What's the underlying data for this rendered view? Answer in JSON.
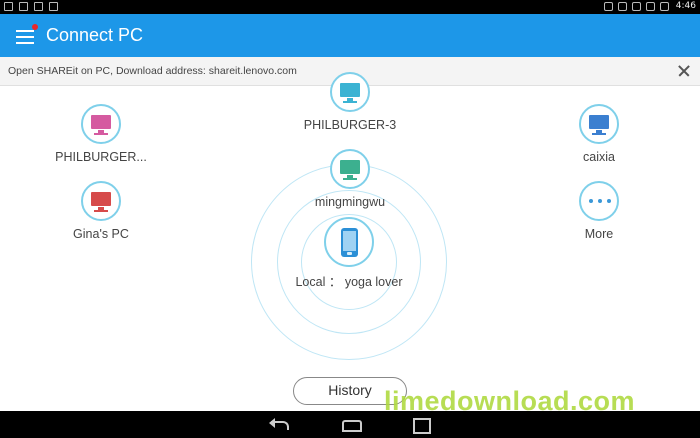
{
  "status_bar": {
    "time": "4:46"
  },
  "app_bar": {
    "title": "Connect PC"
  },
  "banner": {
    "text": "Open SHAREit on PC, Download address: shareit.lenovo.com"
  },
  "devices": [
    {
      "label": "PHILBURGER-3",
      "color": "#3bb3d3"
    },
    {
      "label": "PHILBURGER...",
      "color": "#d55aa0"
    },
    {
      "label": "caixia",
      "color": "#3b7fd0"
    },
    {
      "label": "mingmingwu",
      "color": "#3cb08f"
    },
    {
      "label": "Gina's PC",
      "color": "#d64a4a"
    }
  ],
  "more": {
    "label": "More"
  },
  "local": {
    "label": "Local ： yoga lover"
  },
  "history": {
    "label": "History"
  },
  "watermark": {
    "text": "limedownload.com"
  },
  "colors": {
    "accent": "#1d97e8",
    "ring": "#bfe6f5",
    "notification_dot": "#e8262b"
  }
}
